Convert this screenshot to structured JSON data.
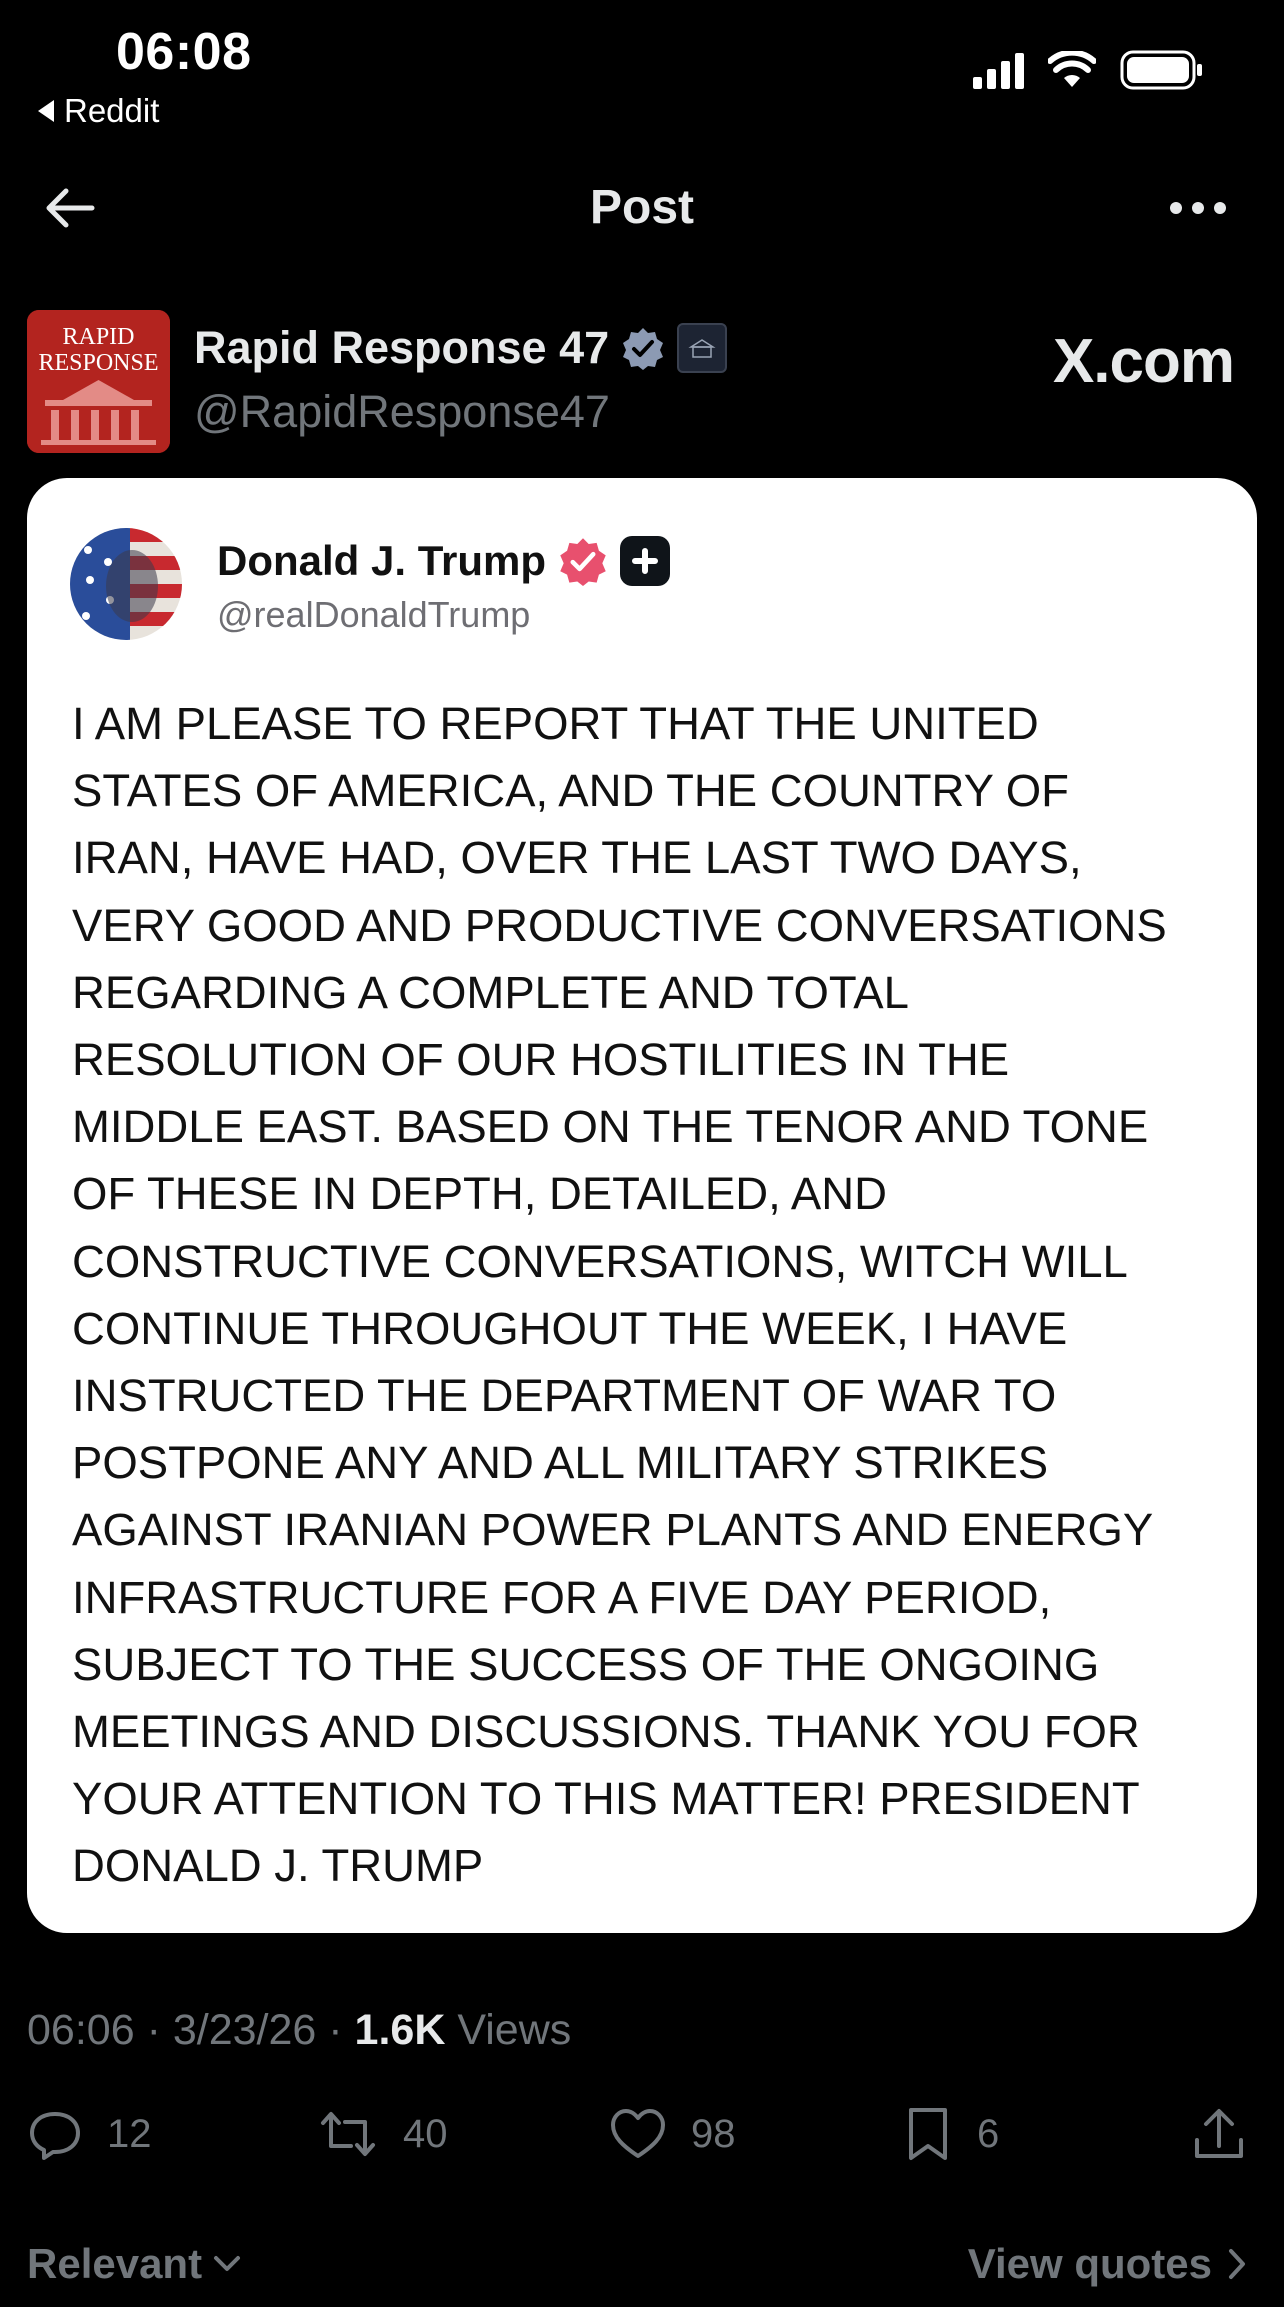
{
  "status_bar": {
    "time": "06:08",
    "back_app": "Reddit"
  },
  "nav": {
    "title": "Post"
  },
  "author": {
    "name": "Rapid Response 47",
    "handle": "@RapidResponse47",
    "avatar_text_line1": "RAPID",
    "avatar_text_line2": "RESPONSE"
  },
  "watermark": "X.com",
  "embedded_post": {
    "name": "Donald J. Trump",
    "handle": "@realDonaldTrump",
    "text": "I AM PLEASE TO REPORT THAT THE UNITED\nSTATES OF AMERICA, AND THE COUNTRY OF\nIRAN, HAVE HAD, OVER THE LAST TWO DAYS,\nVERY GOOD AND PRODUCTIVE CONVERSATIONS\nREGARDING A COMPLETE AND TOTAL\nRESOLUTION OF OUR HOSTILITIES IN THE\nMIDDLE EAST. BASED ON THE TENOR AND TONE\nOF THESE IN DEPTH, DETAILED, AND\nCONSTRUCTIVE CONVERSATIONS, WITCH WILL\nCONTINUE THROUGHOUT THE WEEK, I HAVE\nINSTRUCTED THE DEPARTMENT OF WAR TO\nPOSTPONE ANY AND ALL MILITARY STRIKES\nAGAINST IRANIAN POWER PLANTS AND ENERGY\nINFRASTRUCTURE FOR A FIVE DAY PERIOD,\nSUBJECT TO THE SUCCESS OF THE ONGOING\nMEETINGS AND DISCUSSIONS. THANK YOU FOR\nYOUR ATTENTION TO THIS MATTER! PRESIDENT\nDONALD J. TRUMP"
  },
  "meta": {
    "time": "06:06",
    "date": "3/23/26",
    "views_count": "1.6K",
    "views_label": "Views",
    "separator": "·"
  },
  "actions": {
    "replies": "12",
    "reposts": "40",
    "likes": "98",
    "bookmarks": "6"
  },
  "footer": {
    "sort_label": "Relevant",
    "view_quotes": "View quotes"
  },
  "colors": {
    "background": "#000000",
    "text": "#e7e9ea",
    "muted": "#71767b",
    "verified_blue": "#8c9ab3",
    "verified_pink": "#e8506e",
    "card_bg": "#ffffff"
  }
}
